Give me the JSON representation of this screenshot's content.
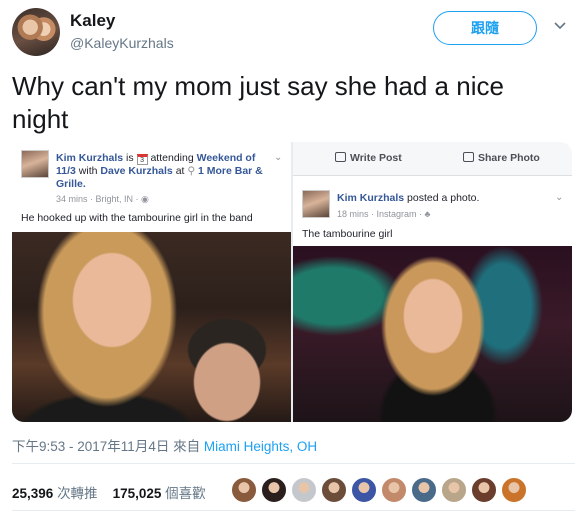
{
  "user": {
    "name": "Kaley",
    "handle": "@KaleyKurzhals",
    "follow_label": "跟隨"
  },
  "tweet": {
    "text": "Why can't my mom just say she had a nice night"
  },
  "fb_left": {
    "author": "Kim Kurzhals",
    "is": "is",
    "cal_num": "3",
    "attending": "attending",
    "event": "Weekend of 11/3",
    "with": "with",
    "companion": "Dave Kurzhals",
    "at": "at",
    "place": "1 More Bar & Grille.",
    "meta": "34 mins · Bright, IN · ◉",
    "message": "He hooked up with the tambourine girl in the band"
  },
  "fb_right": {
    "write_post": "Write Post",
    "share_photo": "Share Photo",
    "author": "Kim Kurzhals",
    "action": "posted a photo.",
    "meta": "18 mins · Instagram · ♣",
    "message": "The tambourine girl"
  },
  "footer": {
    "timestamp": "下午9:53 - 2017年11月4日 來自",
    "location": "Miami Heights, OH",
    "retweets_count": "25,396",
    "retweets_label": "次轉推",
    "likes_count": "175,025",
    "likes_label": "個喜歡"
  },
  "liker_colors": [
    "#8a5a3c",
    "#2a1f1c",
    "#c4c8cc",
    "#6b4d3a",
    "#3c55a5",
    "#c28a6a",
    "#4a6a8a",
    "#b8a58a",
    "#6a3d2c",
    "#c9742a"
  ]
}
